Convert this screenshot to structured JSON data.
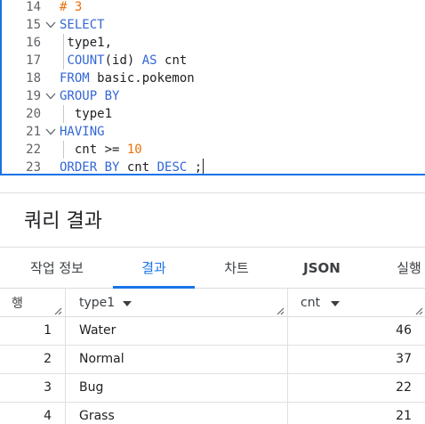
{
  "editor": {
    "lines": [
      {
        "n": "14",
        "tokens": [
          {
            "t": "# 3",
            "c": "cmt"
          }
        ]
      },
      {
        "n": "15",
        "fold": true,
        "tokens": [
          {
            "t": "SELECT",
            "c": "kw"
          }
        ]
      },
      {
        "n": "16",
        "tokens": [
          {
            "t": " type1,",
            "c": "txt"
          }
        ]
      },
      {
        "n": "17",
        "tokens": [
          {
            "t": " ",
            "c": "txt"
          },
          {
            "t": "COUNT",
            "c": "kw"
          },
          {
            "t": "(id) ",
            "c": "txt"
          },
          {
            "t": "AS",
            "c": "kw"
          },
          {
            "t": " cnt",
            "c": "txt"
          }
        ]
      },
      {
        "n": "18",
        "tokens": [
          {
            "t": "FROM",
            "c": "kw"
          },
          {
            "t": " basic.pokemon",
            "c": "txt"
          }
        ]
      },
      {
        "n": "19",
        "fold": true,
        "tokens": [
          {
            "t": "GROUP BY",
            "c": "kw"
          }
        ]
      },
      {
        "n": "20",
        "tokens": [
          {
            "t": "  type1",
            "c": "txt"
          }
        ]
      },
      {
        "n": "21",
        "fold": true,
        "tokens": [
          {
            "t": "HAVING",
            "c": "kw"
          }
        ]
      },
      {
        "n": "22",
        "tokens": [
          {
            "t": "  cnt >= ",
            "c": "txt"
          },
          {
            "t": "10",
            "c": "num"
          }
        ]
      },
      {
        "n": "23",
        "tokens": [
          {
            "t": "ORDER BY",
            "c": "kw"
          },
          {
            "t": " cnt ",
            "c": "txt"
          },
          {
            "t": "DESC",
            "c": "kw"
          },
          {
            "t": " ;",
            "c": "txt"
          }
        ],
        "cursor": true
      }
    ]
  },
  "results": {
    "title": "쿼리 결과",
    "tabs": [
      {
        "label": "작업 정보",
        "active": false
      },
      {
        "label": "결과",
        "active": true
      },
      {
        "label": "차트",
        "active": false
      },
      {
        "label": "JSON",
        "active": false
      },
      {
        "label": "실행",
        "active": false
      }
    ],
    "table": {
      "row_header": "행",
      "columns": [
        "type1",
        "cnt"
      ],
      "rows": [
        {
          "num": "1",
          "type1": "Water",
          "cnt": "46"
        },
        {
          "num": "2",
          "type1": "Normal",
          "cnt": "37"
        },
        {
          "num": "3",
          "type1": "Bug",
          "cnt": "22"
        },
        {
          "num": "4",
          "type1": "Grass",
          "cnt": "21"
        }
      ]
    }
  },
  "colors": {
    "accent": "#1a73e8",
    "keyword": "#3367d6",
    "number": "#e8710a"
  }
}
